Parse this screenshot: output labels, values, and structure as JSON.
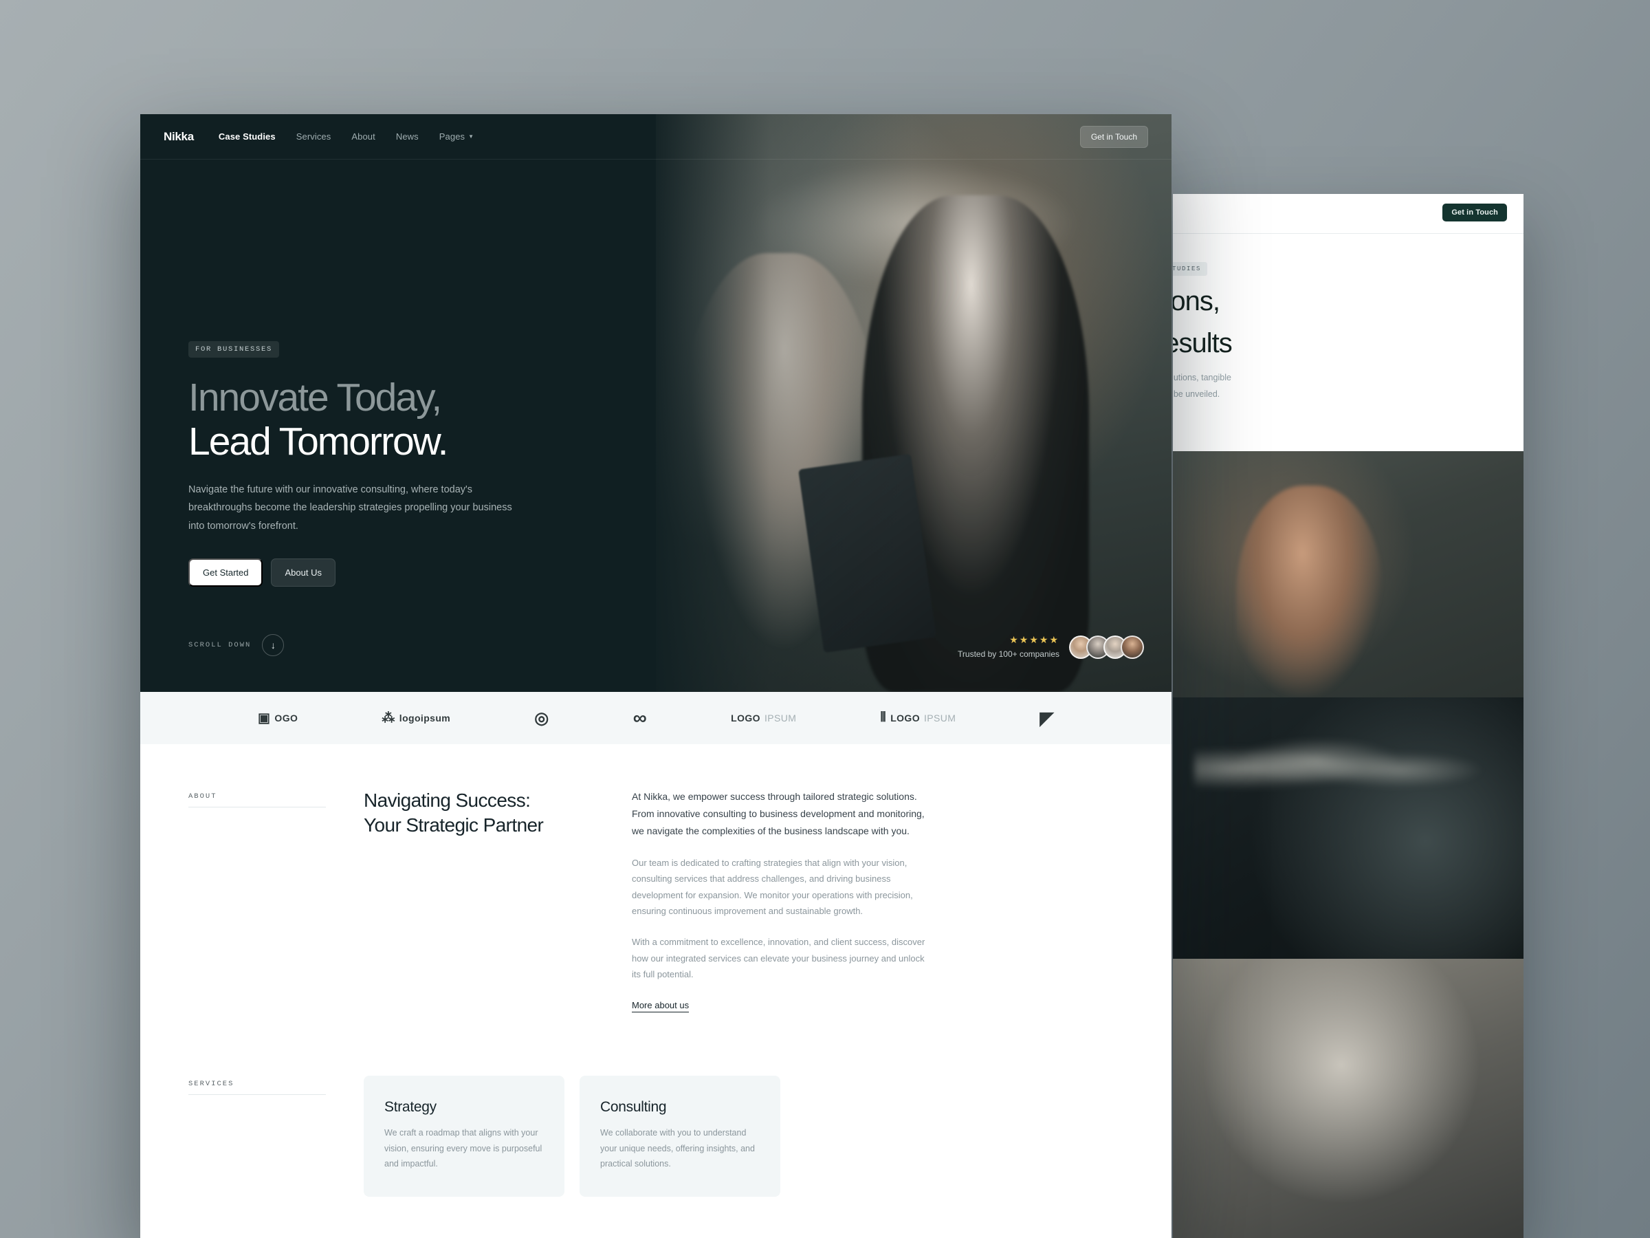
{
  "background_window": {
    "cta_label": "Get in Touch",
    "badge": "CASE STUDIES",
    "heading_line1": "olutions,",
    "heading_line2": "e Results",
    "sub_line1": "—real-world solutions, tangible",
    "sub_line2": "ories waiting to be unveiled."
  },
  "nav": {
    "brand": "Nikka",
    "links": [
      {
        "label": "Case Studies",
        "active": true
      },
      {
        "label": "Services",
        "active": false
      },
      {
        "label": "About",
        "active": false
      },
      {
        "label": "News",
        "active": false
      },
      {
        "label": "Pages",
        "active": false,
        "has_dropdown": true
      }
    ],
    "dropdown_icon": "caret-down-icon",
    "cta_label": "Get in Touch"
  },
  "hero": {
    "tag": "FOR BUSINESSES",
    "heading_line1": "Innovate Today,",
    "heading_line2": "Lead Tomorrow.",
    "subtitle": "Navigate the future with our innovative consulting, where today's breakthroughs become the leadership strategies propelling your business into tomorrow's forefront.",
    "primary_button": "Get Started",
    "secondary_button": "About Us",
    "scroll_label": "SCROLL DOWN",
    "scroll_icon": "arrow-down-icon",
    "trust": {
      "stars": "★★★★★",
      "rating_count": 5,
      "label": "Trusted by 100+ companies",
      "avatar_count": 4
    }
  },
  "logos": [
    {
      "mark": "▣",
      "text": "OGO",
      "light": ""
    },
    {
      "mark": "⁂",
      "text": "logoipsum",
      "light": ""
    },
    {
      "mark": "◎",
      "text": "",
      "light": ""
    },
    {
      "mark": "∞",
      "text": "",
      "light": ""
    },
    {
      "mark": "",
      "text": "LOGO",
      "light": "IPSUM"
    },
    {
      "mark": "⦀",
      "text": "LOGO",
      "light": "IPSUM"
    },
    {
      "mark": "◤",
      "text": "",
      "light": ""
    }
  ],
  "about": {
    "label": "ABOUT",
    "heading_line1": "Navigating Success:",
    "heading_line2": "Your Strategic Partner",
    "paragraph_1": "At Nikka, we empower success through tailored strategic solutions. From innovative consulting to business development and monitoring, we navigate the complexities of the business landscape with you.",
    "paragraph_2": "Our team is dedicated to crafting strategies that align with your vision, consulting services that address challenges, and driving business development for expansion. We monitor your operations with precision, ensuring continuous improvement and sustainable growth.",
    "paragraph_3": "With a commitment to excellence, innovation, and client success, discover how our integrated services can elevate your business journey and unlock its full potential.",
    "link": "More about us"
  },
  "services": {
    "label": "SERVICES",
    "cards": [
      {
        "title": "Strategy",
        "text": "We craft a roadmap that aligns with your vision, ensuring every move is purposeful and impactful."
      },
      {
        "title": "Consulting",
        "text": "We collaborate with you to understand your unique needs, offering insights, and practical solutions."
      }
    ]
  },
  "colors": {
    "hero_bg": "#101f22",
    "accent_dark_green": "#14342f",
    "logo_strip_bg": "#f4f7f8",
    "card_bg": "#f2f6f7",
    "star_gold": "#e8c254",
    "text_dark": "#17242a",
    "text_muted": "#8b969c"
  }
}
